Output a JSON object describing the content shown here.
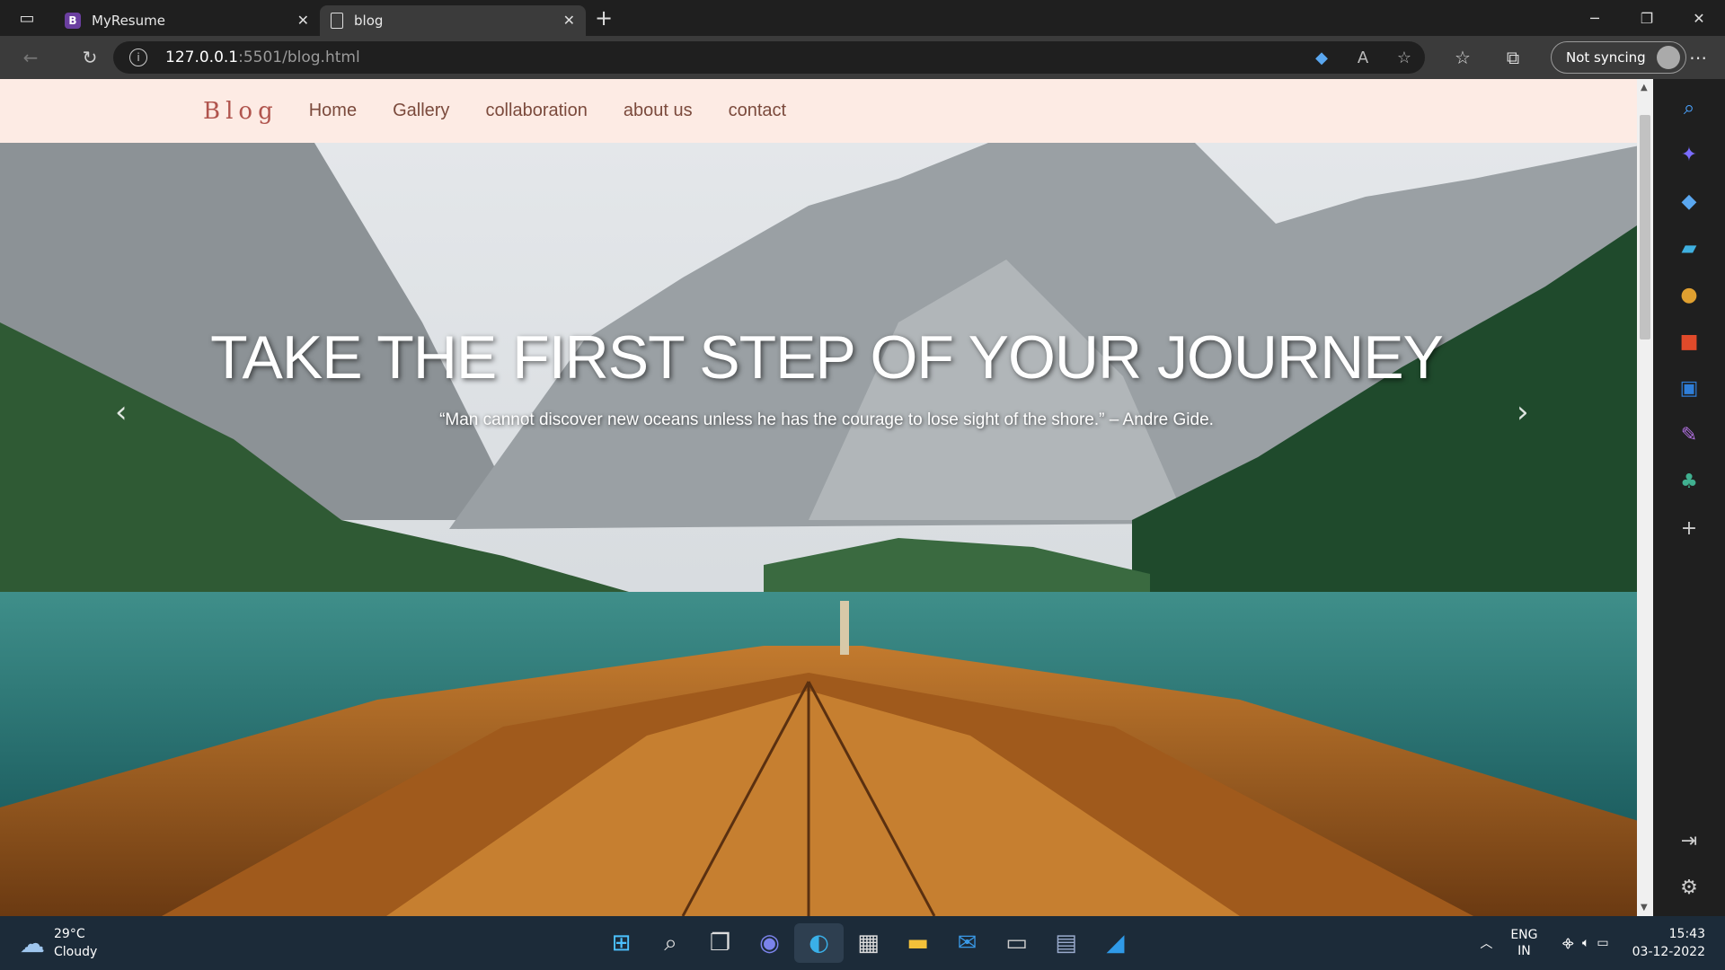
{
  "browser": {
    "tabs": [
      {
        "title": "MyResume",
        "favicon": "B",
        "active": false
      },
      {
        "title": "blog",
        "active": true
      }
    ],
    "address": {
      "host": "127.0.0.1",
      "path": ":5501/blog.html"
    },
    "sync_label": "Not syncing"
  },
  "page": {
    "brand": "Blog",
    "nav": [
      "Home",
      "Gallery",
      "collaboration",
      "about us",
      "contact"
    ],
    "hero": {
      "title": "TAKE THE FIRST STEP OF YOUR JOURNEY",
      "quote": "“Man cannot discover new oceans unless he has the courage to lose sight of the shore.” – Andre Gide."
    }
  },
  "taskbar": {
    "weather": {
      "temp": "29°C",
      "condition": "Cloudy"
    },
    "lang": {
      "line1": "ENG",
      "line2": "IN"
    },
    "clock": {
      "time": "15:43",
      "date": "03-12-2022"
    }
  }
}
